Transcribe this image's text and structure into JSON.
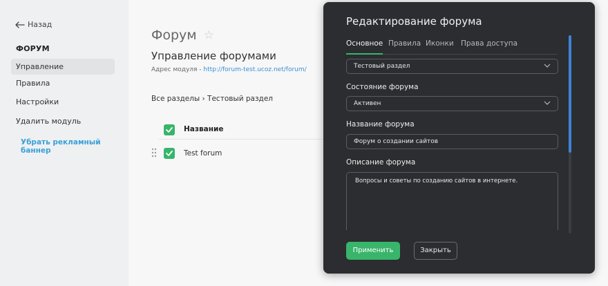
{
  "colors": {
    "accent_green": "#38b56b",
    "link_blue": "#3a8fd0",
    "modal_bg": "#2b2d30",
    "scroll_thumb": "#3d82d6"
  },
  "sidebar": {
    "back_label": "Назад",
    "title": "ФОРУМ",
    "items": [
      {
        "label": "Управление",
        "active": true
      },
      {
        "label": "Правила",
        "active": false
      },
      {
        "label": "Настройки",
        "active": false
      },
      {
        "label": "Удалить модуль",
        "active": false
      }
    ],
    "banner_link": "Убрать рекламный баннер"
  },
  "main": {
    "title": "Форум",
    "subtitle": "Управление форумами",
    "address_label": "Адрес модуля - ",
    "address_url": "http://forum-test.ucoz.net/forum/",
    "breadcrumb": "Все разделы › Тестовый раздел",
    "table": {
      "header": "Название",
      "rows": [
        {
          "name": "Test forum",
          "checked": true
        }
      ]
    }
  },
  "modal": {
    "title": "Редактирование форума",
    "tabs": [
      {
        "label": "Основное",
        "active": true
      },
      {
        "label": "Правила",
        "active": false
      },
      {
        "label": "Иконки",
        "active": false
      },
      {
        "label": "Права доступа",
        "active": false
      }
    ],
    "section_select": "Тестовый раздел",
    "state_label": "Состояние форума",
    "state_value": "Активен",
    "name_label": "Название форума",
    "name_value": "Форум о создании сайтов",
    "desc_label": "Описание форума",
    "desc_value": "Вопросы и советы по созданию сайтов в интернете.",
    "apply_label": "Применить",
    "close_label": "Закрыть"
  }
}
